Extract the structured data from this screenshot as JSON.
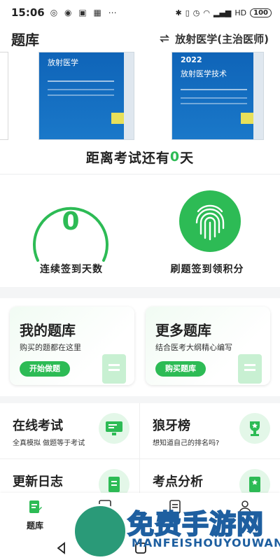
{
  "status_bar": {
    "time": "15:06",
    "battery": "100",
    "indicators": "HD"
  },
  "header": {
    "title": "题库",
    "switch_label": "放射医学(主治医师)"
  },
  "banner": {
    "books": [
      {
        "title": "放射医学",
        "year": ""
      },
      {
        "title": "放射医学技术",
        "year": "2022"
      }
    ]
  },
  "countdown": {
    "prefix": "距离考试还有",
    "days": "0",
    "suffix": "天"
  },
  "signin": {
    "streak_days": "0",
    "streak_label": "连续签到天数",
    "practice_label": "刷题签到领积分"
  },
  "cards": [
    {
      "title": "我的题库",
      "subtitle": "购买的题都在这里",
      "button": "开始做题"
    },
    {
      "title": "更多题库",
      "subtitle": "结合医考大纲精心编写",
      "button": "购买题库"
    }
  ],
  "grid": [
    {
      "title": "在线考试",
      "subtitle": "全真模拟 做题等于考试",
      "icon": "monitor-icon"
    },
    {
      "title": "狼牙榜",
      "subtitle": "想知道自己的排名吗?",
      "icon": "trophy-icon"
    },
    {
      "title": "更新日志",
      "subtitle": "",
      "icon": "log-icon"
    },
    {
      "title": "考点分析",
      "subtitle": "",
      "icon": "analysis-icon"
    }
  ],
  "tabbar": {
    "tabs": [
      {
        "label": "题库"
      }
    ]
  },
  "watermark": {
    "main": "免费手游网",
    "sub": "MANFEISHOUYOUWANG"
  },
  "colors": {
    "accent": "#2dbb55",
    "book_blue": "#0f64b8"
  }
}
